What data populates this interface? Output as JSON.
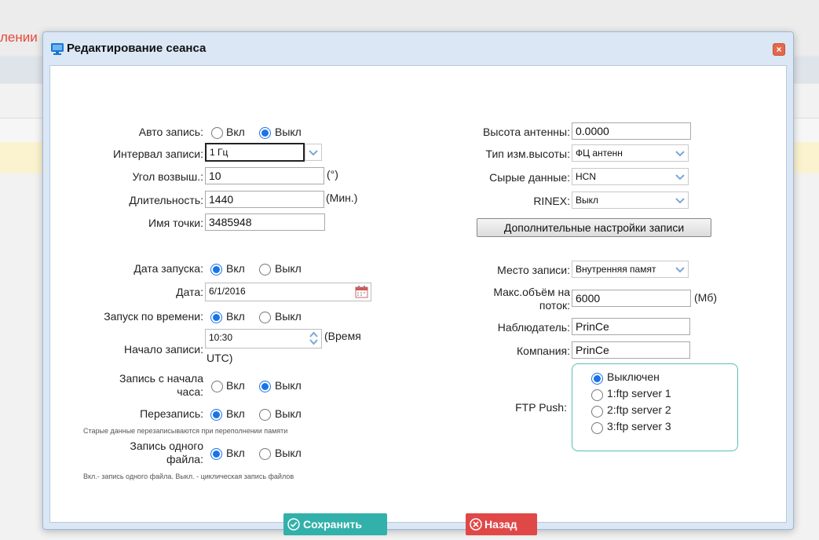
{
  "background": {
    "title_fragment": "лении"
  },
  "dialog": {
    "title": "Редактирование сеанса",
    "close_label": "×",
    "left": {
      "auto_record": {
        "label": "Авто запись:",
        "on": "Вкл",
        "off": "Выкл",
        "selected": "off"
      },
      "interval": {
        "label": "Интервал записи:",
        "value": "1 Гц"
      },
      "elevation": {
        "label": "Угол возвыш.:",
        "value": "10",
        "unit": "(°)"
      },
      "duration": {
        "label": "Длительность:",
        "value": "1440",
        "unit": "(Мин.)"
      },
      "point_name": {
        "label": "Имя точки:",
        "value": "3485948"
      },
      "start_date_toggle": {
        "label": "Дата запуска:",
        "on": "Вкл",
        "off": "Выкл",
        "selected": "on"
      },
      "date": {
        "label": "Дата:",
        "value": "6/1/2016"
      },
      "time_start_toggle": {
        "label": "Запуск по времени:",
        "on": "Вкл",
        "off": "Выкл",
        "selected": "on"
      },
      "record_start": {
        "label": "Начало записи:",
        "value": "10:30",
        "unit_line1": "(Время",
        "unit_line2": "UTC)"
      },
      "hour_start": {
        "label_line1": "Запись с начала",
        "label_line2": "часа:",
        "on": "Вкл",
        "off": "Выкл",
        "selected": "off"
      },
      "overwrite": {
        "label": "Перезапись:",
        "on": "Вкл",
        "off": "Выкл",
        "selected": "on",
        "hint": "Старые данные перезаписываются при переполнении памяти"
      },
      "single_file": {
        "label_line1": "Запись одного",
        "label_line2": "файла:",
        "on": "Вкл",
        "off": "Выкл",
        "selected": "on",
        "hint": "Вкл.- запись одного файла. Выкл. - циклическая запись файлов"
      }
    },
    "right": {
      "antenna_height": {
        "label": "Высота антенны:",
        "value": "0.0000"
      },
      "height_type": {
        "label": "Тип изм.высоты:",
        "value": "ФЦ антенн"
      },
      "raw_data": {
        "label": "Сырые данные:",
        "value": "HCN"
      },
      "rinex": {
        "label": "RINEX:",
        "value": "Выкл"
      },
      "extra_settings_button": "Дополнительные настройки записи",
      "storage": {
        "label": "Место записи:",
        "value": "Внутренняя памят"
      },
      "max_size": {
        "label_line1": "Макс.объём на",
        "label_line2": "поток:",
        "value": "6000",
        "unit": "(Мб)"
      },
      "observer": {
        "label": "Наблюдатель:",
        "value": "PrinCe"
      },
      "company": {
        "label": "Компания:",
        "value": "PrinCe"
      },
      "ftp_push": {
        "label": "FTP Push:",
        "options": [
          "Выключен",
          "1:ftp server 1",
          "2:ftp server 2",
          "3:ftp server 3"
        ],
        "selected_index": 0
      }
    },
    "buttons": {
      "save": "Сохранить",
      "back": "Назад"
    }
  }
}
